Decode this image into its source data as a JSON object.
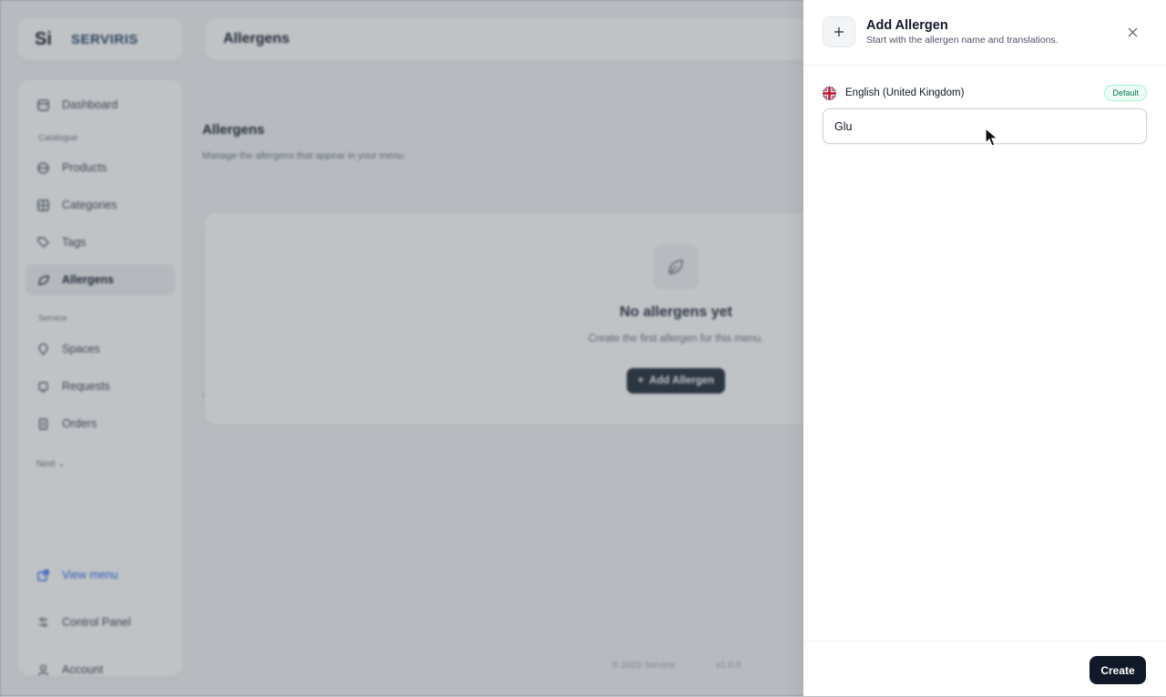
{
  "brand": {
    "mark": "Si",
    "name": "SERVIRIS"
  },
  "sidebar": {
    "items": [
      {
        "label": "Dashboard",
        "icon": "dashboard-icon"
      },
      {
        "label": "Products",
        "icon": "box-icon"
      },
      {
        "label": "Categories",
        "icon": "grid-icon"
      },
      {
        "label": "Tags",
        "icon": "tag-icon"
      },
      {
        "label": "Allergens",
        "icon": "leaf-icon"
      },
      {
        "label": "Spaces",
        "icon": "location-icon"
      },
      {
        "label": "Requests",
        "icon": "bell-icon"
      },
      {
        "label": "Orders",
        "icon": "receipt-icon"
      }
    ],
    "groups": {
      "catalogue": "Catalogue",
      "service": "Service"
    },
    "more": "Next",
    "view_menu": "View menu",
    "control_panel": "Control Panel",
    "account": "Account"
  },
  "topbar": {
    "title": "Allergens"
  },
  "page": {
    "heading": "Allergens",
    "subtitle": "Manage the allergens that appear in your menu.",
    "empty": {
      "title": "No allergens yet",
      "subtitle": "Create the first allergen for this menu.",
      "button": "Add Allergen"
    },
    "footer_left": "© 2025 Serviris",
    "footer_right": "v1.0.0"
  },
  "sheet": {
    "title": "Add Allergen",
    "subtitle": "Start with the allergen name and translations.",
    "language": "English (United Kingdom)",
    "default_badge": "Default",
    "name_value": "Glu",
    "create_label": "Create"
  },
  "colors": {
    "primary": "#111827",
    "accent_link": "#2563eb",
    "badge_green": "#047857"
  }
}
